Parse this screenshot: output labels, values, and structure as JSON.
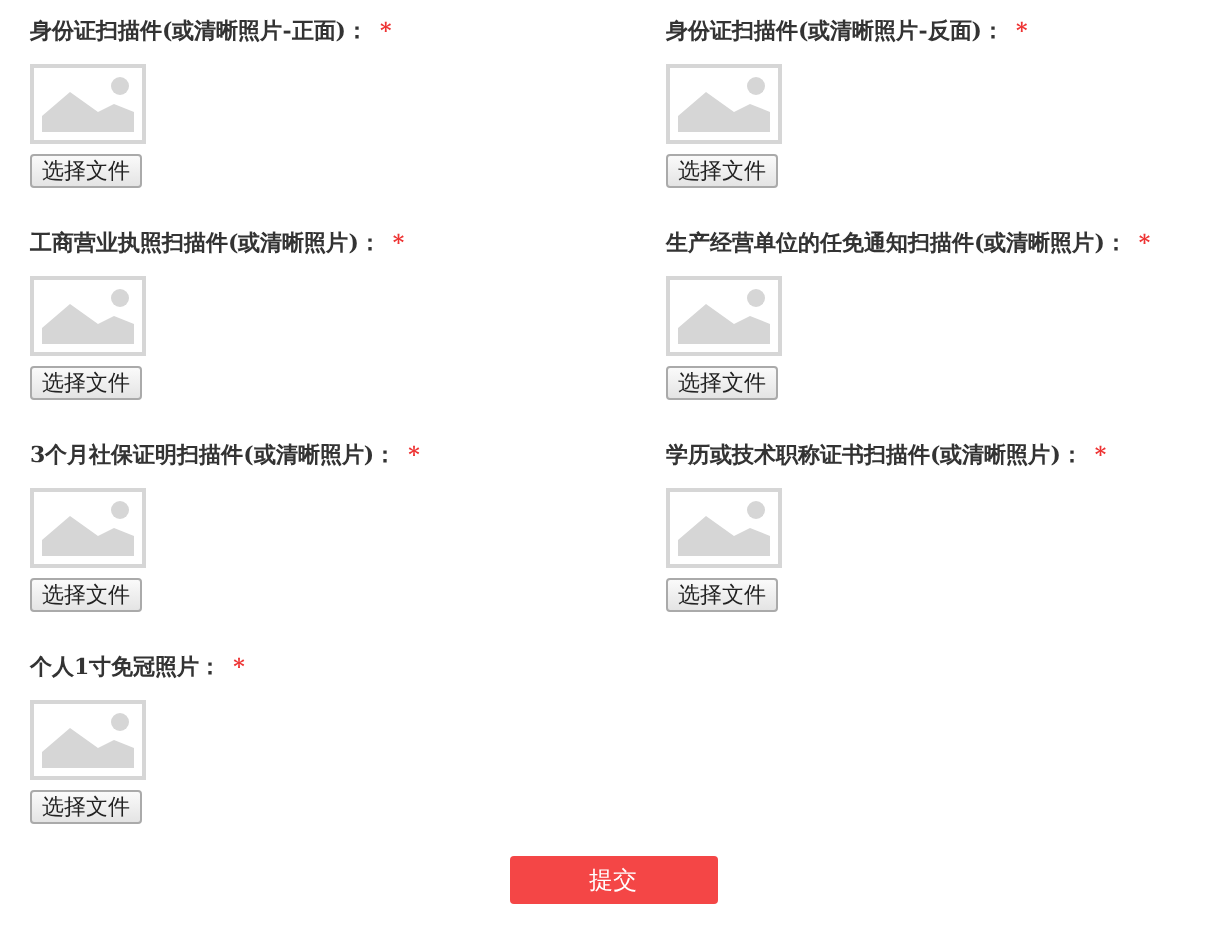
{
  "columns": [
    {
      "fields": [
        {
          "label": "身份证扫描件(或清晰照片-正面)：",
          "required": true,
          "button": "选择文件"
        },
        {
          "label": "工商营业执照扫描件(或清晰照片)：",
          "required": true,
          "button": "选择文件"
        },
        {
          "label": "3个月社保证明扫描件(或清晰照片)：",
          "required": true,
          "button": "选择文件"
        },
        {
          "label": "个人1寸免冠照片：",
          "required": true,
          "button": "选择文件"
        }
      ]
    },
    {
      "fields": [
        {
          "label": "身份证扫描件(或清晰照片-反面)：",
          "required": true,
          "button": "选择文件"
        },
        {
          "label": "生产经营单位的任免通知扫描件(或清晰照片)：",
          "required": true,
          "button": "选择文件"
        },
        {
          "label": "学历或技术职称证书扫描件(或清晰照片)：",
          "required": true,
          "button": "选择文件"
        }
      ]
    }
  ],
  "required_mark": "*",
  "submit": "提交"
}
